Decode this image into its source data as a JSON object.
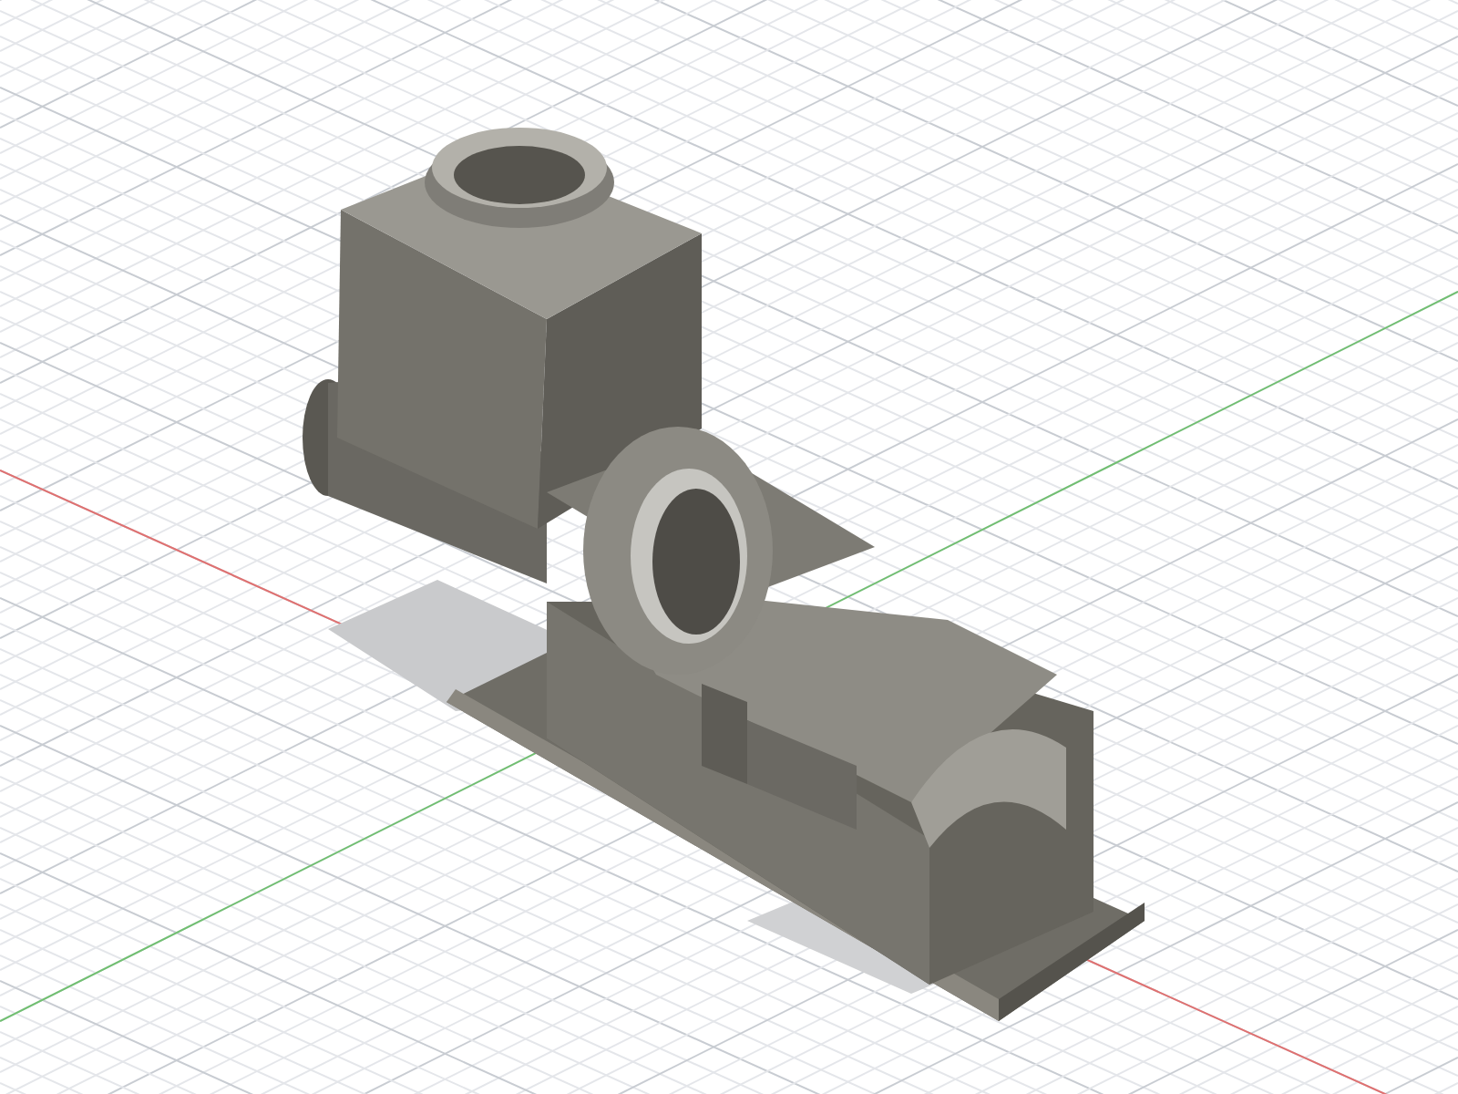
{
  "viewport": {
    "kind": "isometric"
  }
}
